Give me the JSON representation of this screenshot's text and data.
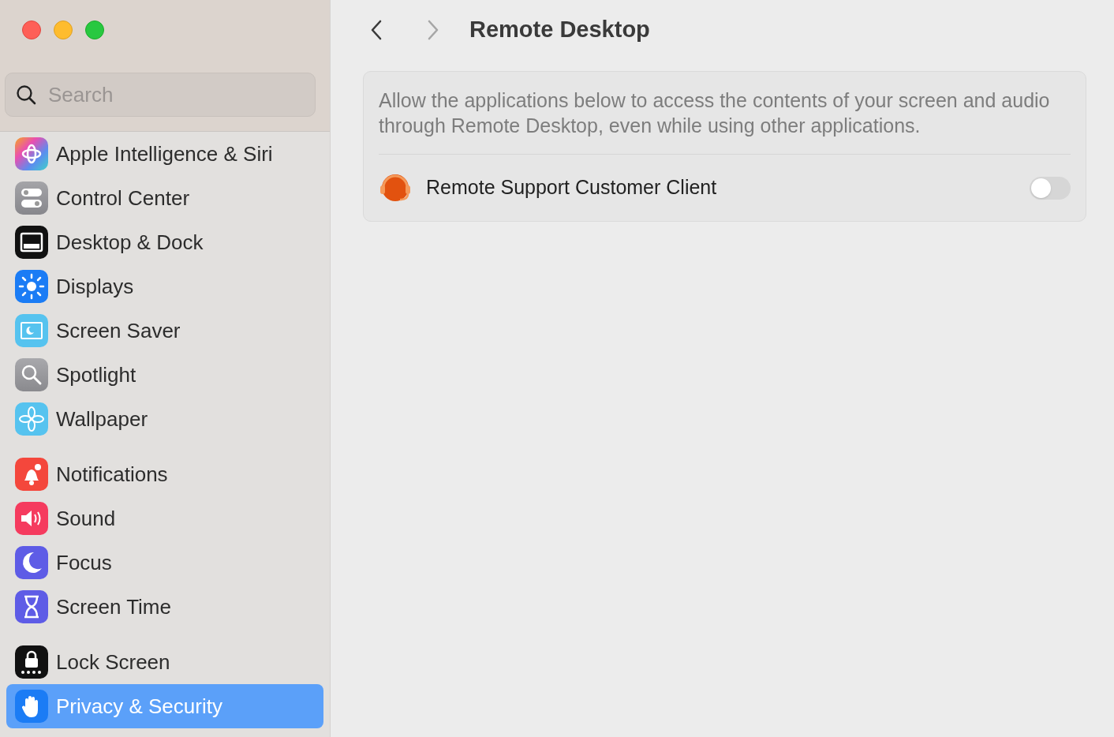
{
  "sidebar": {
    "search": {
      "placeholder": "Search"
    },
    "groups": [
      {
        "items": [
          {
            "label": "Apple Intelligence & Siri",
            "selected": false
          },
          {
            "label": "Control Center",
            "selected": false
          },
          {
            "label": "Desktop & Dock",
            "selected": false
          },
          {
            "label": "Displays",
            "selected": false
          },
          {
            "label": "Screen Saver",
            "selected": false
          },
          {
            "label": "Spotlight",
            "selected": false
          },
          {
            "label": "Wallpaper",
            "selected": false
          }
        ]
      },
      {
        "items": [
          {
            "label": "Notifications",
            "selected": false
          },
          {
            "label": "Sound",
            "selected": false
          },
          {
            "label": "Focus",
            "selected": false
          },
          {
            "label": "Screen Time",
            "selected": false
          }
        ]
      },
      {
        "items": [
          {
            "label": "Lock Screen",
            "selected": false
          },
          {
            "label": "Privacy & Security",
            "selected": true
          }
        ]
      }
    ]
  },
  "toolbar": {
    "back_disabled": false,
    "forward_disabled": true,
    "title": "Remote Desktop"
  },
  "panel": {
    "description": "Allow the applications below to access the contents of your screen and audio through Remote Desktop, even while using other applications.",
    "apps": [
      {
        "name": "Remote Support Customer Client",
        "on": false
      }
    ]
  }
}
